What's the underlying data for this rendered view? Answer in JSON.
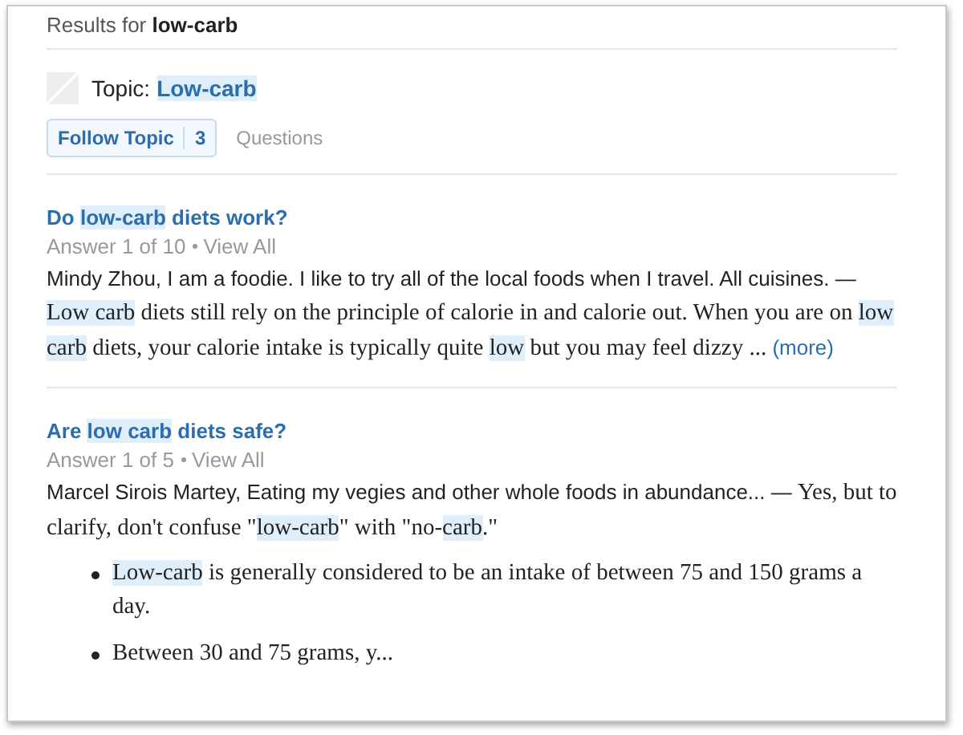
{
  "header": {
    "prefix": "Results for",
    "query": "low-carb"
  },
  "topic": {
    "label": "Topic:",
    "name": "Low-carb",
    "name_highlighted": true
  },
  "follow_button": {
    "label": "Follow Topic",
    "count": "3"
  },
  "questions_link": "Questions",
  "results": [
    {
      "title": [
        {
          "text": "Do ",
          "highlighted": false
        },
        {
          "text": "low-carb",
          "highlighted": true
        },
        {
          "text": " diets work?",
          "highlighted": false
        }
      ],
      "meta": "Answer 1 of 10",
      "view_all": "View All",
      "byline": "Mindy Zhou, I am a foodie. I like to try all of the local foods when I travel. All cuisines. —",
      "segments": [
        {
          "text": "Low carb",
          "highlighted": true
        },
        {
          "text": " diets still rely on the principle of calorie in and calorie out. When you are on ",
          "highlighted": false
        },
        {
          "text": "low carb",
          "highlighted": true
        },
        {
          "text": " diets, your calorie intake is typically quite ",
          "highlighted": false
        },
        {
          "text": "low",
          "highlighted": true
        },
        {
          "text": " but you may feel dizzy ...",
          "highlighted": false
        }
      ],
      "more": "(more)"
    },
    {
      "title": [
        {
          "text": "Are ",
          "highlighted": false
        },
        {
          "text": "low carb",
          "highlighted": true
        },
        {
          "text": " diets safe?",
          "highlighted": false
        }
      ],
      "meta": "Answer 1 of 5",
      "view_all": "View All",
      "byline": "Marcel Sirois Martey, Eating my vegies and other whole foods in abundance... —",
      "segments": [
        {
          "text": "Yes, but to clarify, don't confuse \"",
          "highlighted": false
        },
        {
          "text": "low-carb",
          "highlighted": true
        },
        {
          "text": "\" with \"no-",
          "highlighted": false
        },
        {
          "text": "carb",
          "highlighted": true
        },
        {
          "text": ".\"",
          "highlighted": false
        }
      ],
      "bullets": [
        [
          {
            "text": "Low-carb",
            "highlighted": true
          },
          {
            "text": " is generally considered to be an intake of between 75 and 150 grams a day.",
            "highlighted": false
          }
        ],
        [
          {
            "text": "Between 30 and 75 grams, y...",
            "highlighted": false
          }
        ]
      ]
    }
  ]
}
